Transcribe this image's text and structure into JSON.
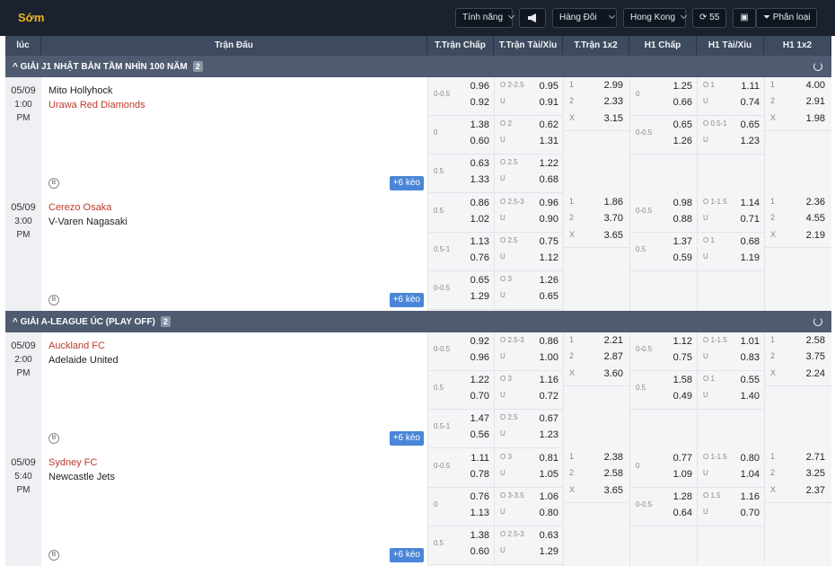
{
  "topbar": {
    "brand": "Sớm",
    "features": "Tính năng",
    "sort": "Hàng Đôi",
    "odds_type": "Hong Kong",
    "refresh_count": "55",
    "category": "Phân loại"
  },
  "headers": [
    "lúc",
    "Trận Đấu",
    "T.Trận Chấp",
    "T.Trận Tài/Xỉu",
    "T.Trận 1x2",
    "H1 Chấp",
    "H1 Tài/Xỉu",
    "H1 1x2"
  ],
  "leagues": [
    {
      "name": "GIẢI J1 NHẬT BẢN TẦM NHÌN 100 NĂM",
      "count": "2",
      "matches": [
        {
          "date": "05/09",
          "time": "1:00",
          "ampm": "PM",
          "team1": "Mito Hollyhock",
          "team2": "Urawa Red Diamonds",
          "home_team": 2,
          "more": "+6 kèo",
          "rows": [
            {
              "hdp": {
                "line": "0-0.5",
                "a": "0.96",
                "b": "0.92"
              },
              "ou": {
                "line": "O 2-2.5",
                "a": "0.95",
                "b": "0.91"
              },
              "x12": {
                "one": "2.99",
                "two": "2.33",
                "x": "3.15"
              },
              "h1hdp": {
                "line": "0",
                "a": "1.25",
                "b": "0.66"
              },
              "h1ou": {
                "line": "O 1",
                "a": "1.11",
                "b": "0.74"
              },
              "h1x12": {
                "one": "4.00",
                "two": "2.91",
                "x": "1.98"
              }
            },
            {
              "hdp": {
                "line": "0",
                "a": "1.38",
                "b": "0.60"
              },
              "ou": {
                "line": "O 2",
                "a": "0.62",
                "b": "1.31"
              },
              "h1hdp": {
                "line": "0-0.5",
                "a": "0.65",
                "b": "1.26"
              },
              "h1ou": {
                "line": "O 0.5-1",
                "a": "0.65",
                "b": "1.23"
              }
            },
            {
              "hdp": {
                "line": "0.5",
                "a": "0.63",
                "b": "1.33"
              },
              "ou": {
                "line": "O 2.5",
                "a": "1.22",
                "b": "0.68"
              }
            }
          ]
        },
        {
          "date": "05/09",
          "time": "3:00",
          "ampm": "PM",
          "team1": "Cerezo Osaka",
          "team2": "V-Varen Nagasaki",
          "home_team": 1,
          "more": "+6 kèo",
          "rows": [
            {
              "hdp": {
                "line": "0.5",
                "a": "0.86",
                "b": "1.02"
              },
              "ou": {
                "line": "O 2.5-3",
                "a": "0.96",
                "b": "0.90"
              },
              "x12": {
                "one": "1.86",
                "two": "3.70",
                "x": "3.65"
              },
              "h1hdp": {
                "line": "0-0.5",
                "a": "0.98",
                "b": "0.88"
              },
              "h1ou": {
                "line": "O 1-1.5",
                "a": "1.14",
                "b": "0.71"
              },
              "h1x12": {
                "one": "2.36",
                "two": "4.55",
                "x": "2.19"
              }
            },
            {
              "hdp": {
                "line": "0.5-1",
                "a": "1.13",
                "b": "0.76"
              },
              "ou": {
                "line": "O 2.5",
                "a": "0.75",
                "b": "1.12"
              },
              "h1hdp": {
                "line": "0.5",
                "a": "1.37",
                "b": "0.59"
              },
              "h1ou": {
                "line": "O 1",
                "a": "0.68",
                "b": "1.19"
              }
            },
            {
              "hdp": {
                "line": "0-0.5",
                "a": "0.65",
                "b": "1.29"
              },
              "ou": {
                "line": "O 3",
                "a": "1.26",
                "b": "0.65"
              }
            }
          ]
        }
      ]
    },
    {
      "name": "GIẢI A-LEAGUE ÚC (PLAY OFF)",
      "count": "2",
      "matches": [
        {
          "date": "05/09",
          "time": "2:00",
          "ampm": "PM",
          "team1": "Auckland FC",
          "team2": "Adelaide United",
          "home_team": 1,
          "more": "+6 kèo",
          "rows": [
            {
              "hdp": {
                "line": "0-0.5",
                "a": "0.92",
                "b": "0.96"
              },
              "ou": {
                "line": "O 2.5-3",
                "a": "0.86",
                "b": "1.00"
              },
              "x12": {
                "one": "2.21",
                "two": "2.87",
                "x": "3.60"
              },
              "h1hdp": {
                "line": "0-0.5",
                "a": "1.12",
                "b": "0.75"
              },
              "h1ou": {
                "line": "O 1-1.5",
                "a": "1.01",
                "b": "0.83"
              },
              "h1x12": {
                "one": "2.58",
                "two": "3.75",
                "x": "2.24"
              }
            },
            {
              "hdp": {
                "line": "0.5",
                "a": "1.22",
                "b": "0.70"
              },
              "ou": {
                "line": "O 3",
                "a": "1.16",
                "b": "0.72"
              },
              "h1hdp": {
                "line": "0.5",
                "a": "1.58",
                "b": "0.49"
              },
              "h1ou": {
                "line": "O 1",
                "a": "0.55",
                "b": "1.40"
              }
            },
            {
              "hdp": {
                "line": "0.5-1",
                "a": "1.47",
                "b": "0.56"
              },
              "ou": {
                "line": "O 2.5",
                "a": "0.67",
                "b": "1.23"
              }
            }
          ]
        },
        {
          "date": "05/09",
          "time": "5:40",
          "ampm": "PM",
          "team1": "Sydney FC",
          "team2": "Newcastle Jets",
          "home_team": 1,
          "more": "+6 kèo",
          "rows": [
            {
              "hdp": {
                "line": "0-0.5",
                "a": "1.11",
                "b": "0.78"
              },
              "ou": {
                "line": "O 3",
                "a": "0.81",
                "b": "1.05"
              },
              "x12": {
                "one": "2.38",
                "two": "2.58",
                "x": "3.65"
              },
              "h1hdp": {
                "line": "0",
                "a": "0.77",
                "b": "1.09"
              },
              "h1ou": {
                "line": "O 1-1.5",
                "a": "0.80",
                "b": "1.04"
              },
              "h1x12": {
                "one": "2.71",
                "two": "3.25",
                "x": "2.37"
              }
            },
            {
              "hdp": {
                "line": "0",
                "a": "0.76",
                "b": "1.13"
              },
              "ou": {
                "line": "O 3-3.5",
                "a": "1.06",
                "b": "0.80"
              },
              "h1hdp": {
                "line": "0-0.5",
                "a": "1.28",
                "b": "0.64"
              },
              "h1ou": {
                "line": "O 1.5",
                "a": "1.16",
                "b": "0.70"
              }
            },
            {
              "hdp": {
                "line": "0.5",
                "a": "1.38",
                "b": "0.60"
              },
              "ou": {
                "line": "O 2.5-3",
                "a": "0.63",
                "b": "1.29"
              }
            }
          ]
        }
      ]
    }
  ],
  "labels": {
    "under": "U",
    "one": "1",
    "two": "2",
    "x": "X",
    "b": "B"
  }
}
